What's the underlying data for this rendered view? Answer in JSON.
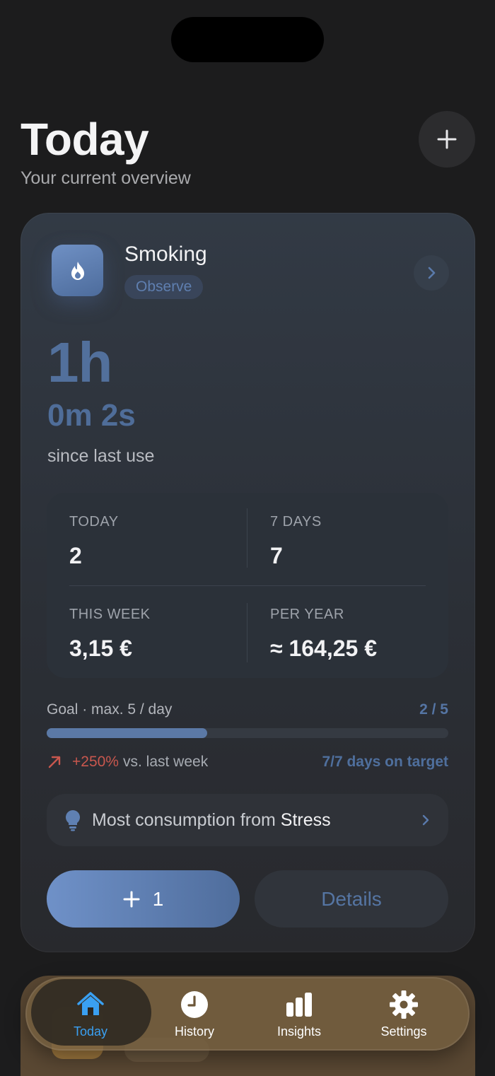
{
  "header": {
    "title": "Today",
    "subtitle": "Your current overview"
  },
  "card": {
    "name": "Smoking",
    "mode": "Observe",
    "timer_hours": "1h",
    "timer_rest": "0m 2s",
    "since_label": "since last use",
    "stats": {
      "today_label": "TODAY",
      "today_value": "2",
      "seven_days_label": "7 DAYS",
      "seven_days_value": "7",
      "this_week_label": "THIS WEEK",
      "this_week_value": "3,15 €",
      "per_year_label": "PER YEAR",
      "per_year_value": "≈ 164,25 €"
    },
    "goal": {
      "label": "Goal · max. 5 / day",
      "count": "2 / 5",
      "progress_fraction": 0.4
    },
    "trend": {
      "percent": "+250%",
      "text": "vs. last week",
      "on_target": "7/7 days on target"
    },
    "insight": {
      "prefix": "Most consumption from",
      "trigger": "Stress"
    },
    "plus_label": "1",
    "details_label": "Details"
  },
  "tabbar": {
    "tabs": [
      {
        "label": "Today",
        "icon": "home-icon",
        "active": true
      },
      {
        "label": "History",
        "icon": "clock-icon",
        "active": false
      },
      {
        "label": "Insights",
        "icon": "bar-chart-icon",
        "active": false
      },
      {
        "label": "Settings",
        "icon": "gear-icon",
        "active": false
      }
    ]
  },
  "colors": {
    "accent": "#5b79a6",
    "active_tab": "#3aa0f2",
    "trend_up": "#c9574e"
  }
}
